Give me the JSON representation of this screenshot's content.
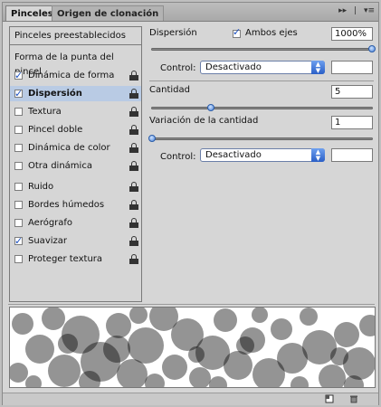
{
  "tabs": {
    "active": "Pinceles",
    "inactive": "Origen de clonación"
  },
  "tab_controls": {
    "expand": "▸▸",
    "divider": "|",
    "menu": "▾≡"
  },
  "left": {
    "preset_button": "Pinceles preestablecidos",
    "tip_shape": "Forma de la punta del pincel",
    "options": [
      {
        "label": "Dinámica de forma",
        "checked": true
      },
      {
        "label": "Dispersión",
        "checked": true
      },
      {
        "label": "Textura",
        "checked": false
      },
      {
        "label": "Pincel doble",
        "checked": false
      },
      {
        "label": "Dinámica de color",
        "checked": false
      },
      {
        "label": "Otra dinámica",
        "checked": false
      },
      {
        "label": "Ruido",
        "checked": false
      },
      {
        "label": "Bordes húmedos",
        "checked": false
      },
      {
        "label": "Aerógrafo",
        "checked": false
      },
      {
        "label": "Suavizar",
        "checked": true
      },
      {
        "label": "Proteger textura",
        "checked": false
      }
    ]
  },
  "right": {
    "dispersion_label": "Dispersión",
    "ambos_label": "Ambos ejes",
    "ambos_checked": true,
    "dispersion_value": "1000%",
    "control1_label": "Control:",
    "control1_value": "Desactivado",
    "cantidad_label": "Cantidad",
    "cantidad_value": "5",
    "variacion_label": "Variación de la cantidad",
    "variacion_value": "1",
    "control2_label": "Control:",
    "control2_value": "Desactivado"
  },
  "colors": {
    "selection": "#b9cbe4",
    "accent": "#2a5fc7",
    "panel": "#d6d6d6"
  },
  "icons": [
    "lock-icon",
    "new-brush-icon",
    "trash-icon",
    "checkbox-icon",
    "dropdown-arrow-icon"
  ]
}
